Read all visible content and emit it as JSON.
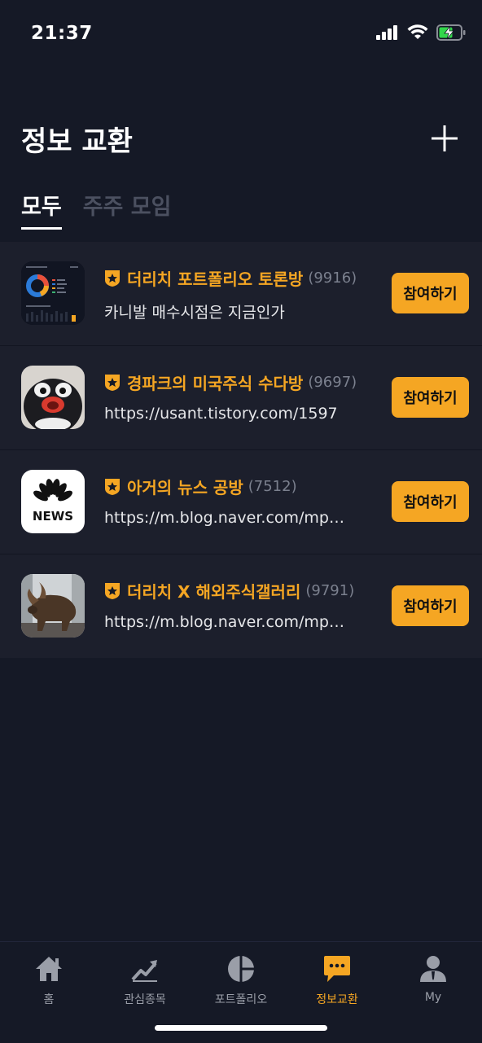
{
  "status_bar": {
    "time": "21:37"
  },
  "header": {
    "title": "정보 교환",
    "add_icon": "plus-icon"
  },
  "tabs": [
    {
      "label": "모두",
      "active": true
    },
    {
      "label": "주주 모임",
      "active": false
    }
  ],
  "rooms": [
    {
      "title": "더리치 포트폴리오 토론방",
      "count": "(9916)",
      "description": "카니발 매수시점은 지금인가",
      "button": "참여하기",
      "thumbnail": "portfolio-chart-thumbnail"
    },
    {
      "title": "경파크의 미국주식 수다방",
      "count": "(9697)",
      "description": "https://usant.tistory.com/1597",
      "button": "참여하기",
      "thumbnail": "penguin-thumbnail"
    },
    {
      "title": "아거의 뉴스 공방",
      "count": "(7512)",
      "description": "https://m.blog.naver.com/mp…",
      "button": "참여하기",
      "thumbnail": "nbc-news-logo",
      "thumbnail_text": "NEWS"
    },
    {
      "title": "더리치 X 해외주식갤러리",
      "count": "(9791)",
      "description": "https://m.blog.naver.com/mp…",
      "button": "참여하기",
      "thumbnail": "bull-statue-thumbnail"
    }
  ],
  "bottom_nav": [
    {
      "label": "홈",
      "icon": "home-icon"
    },
    {
      "label": "관심종목",
      "icon": "trend-chart-icon"
    },
    {
      "label": "포트폴리오",
      "icon": "pie-chart-icon"
    },
    {
      "label": "정보교환",
      "icon": "chat-bubble-icon",
      "active": true
    },
    {
      "label": "My",
      "icon": "user-icon"
    }
  ],
  "colors": {
    "background": "#151926",
    "list_background": "#1c1f2c",
    "accent": "#f5a623",
    "muted": "#7b808e"
  }
}
